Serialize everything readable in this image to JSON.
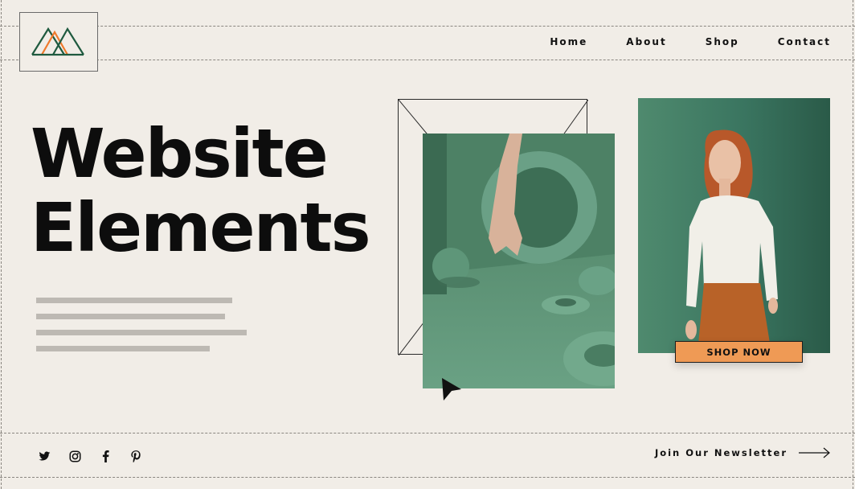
{
  "nav": {
    "items": [
      "Home",
      "About",
      "Shop",
      "Contact"
    ]
  },
  "hero": {
    "title_line1": "Website",
    "title_line2": "Elements"
  },
  "cta": {
    "shop_label": "SHOP NOW"
  },
  "footer": {
    "newsletter_label": "Join Our Newsletter",
    "social_icons": [
      "twitter-icon",
      "instagram-icon",
      "facebook-icon",
      "pinterest-icon"
    ]
  },
  "colors": {
    "background": "#f1ede7",
    "accent_orange": "#ef9a55",
    "brand_green": "#1f5a3f",
    "photo_green": "#5f9476"
  }
}
